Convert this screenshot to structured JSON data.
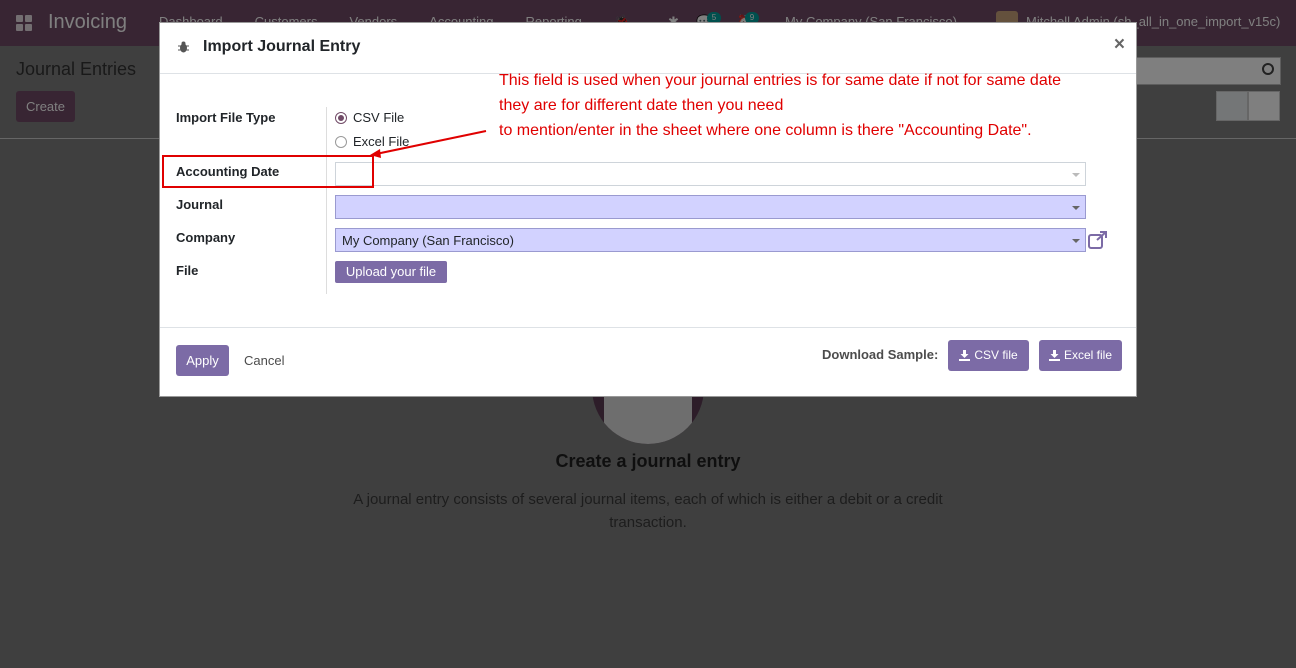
{
  "navbar": {
    "brand": "Invoicing",
    "menu": [
      "Dashboard",
      "Customers",
      "Vendors",
      "Accounting",
      "Reporting"
    ],
    "messages_count": "5",
    "activities_count": "9",
    "company": "My Company (San Francisco)",
    "user": "Mitchell Admin (sh_all_in_one_import_v15c)"
  },
  "control_panel": {
    "title": "Journal Entries",
    "create_label": "Create"
  },
  "helper": {
    "title": "Create a journal entry",
    "text": "A journal entry consists of several journal items, each of which is either a debit or a credit transaction."
  },
  "modal": {
    "title": "Import Journal Entry",
    "close": "×",
    "fields": {
      "file_type_label": "Import File Type",
      "option_csv": "CSV File",
      "option_excel": "Excel File",
      "selected_option": "CSV File",
      "accounting_date_label": "Accounting Date",
      "accounting_date_value": "",
      "journal_label": "Journal",
      "journal_value": "",
      "company_label": "Company",
      "company_value": "My Company (San Francisco)",
      "file_label": "File",
      "upload_label": "Upload your file"
    },
    "footer": {
      "apply_label": "Apply",
      "cancel_label": "Cancel",
      "download_label": "Download Sample:",
      "csv_sample_label": "CSV file",
      "excel_sample_label": "Excel file"
    }
  },
  "annotation": {
    "lines": [
      "This field is used when your journal entries is for same date if not for same date",
      "they are for different date then you need",
      "to mention/enter in the sheet where one column is there \"Accounting Date\"."
    ],
    "color": "#e00000"
  },
  "colors": {
    "brand": "#714b67",
    "button": "#7c6ba6",
    "required_field": "#d2d2ff"
  }
}
